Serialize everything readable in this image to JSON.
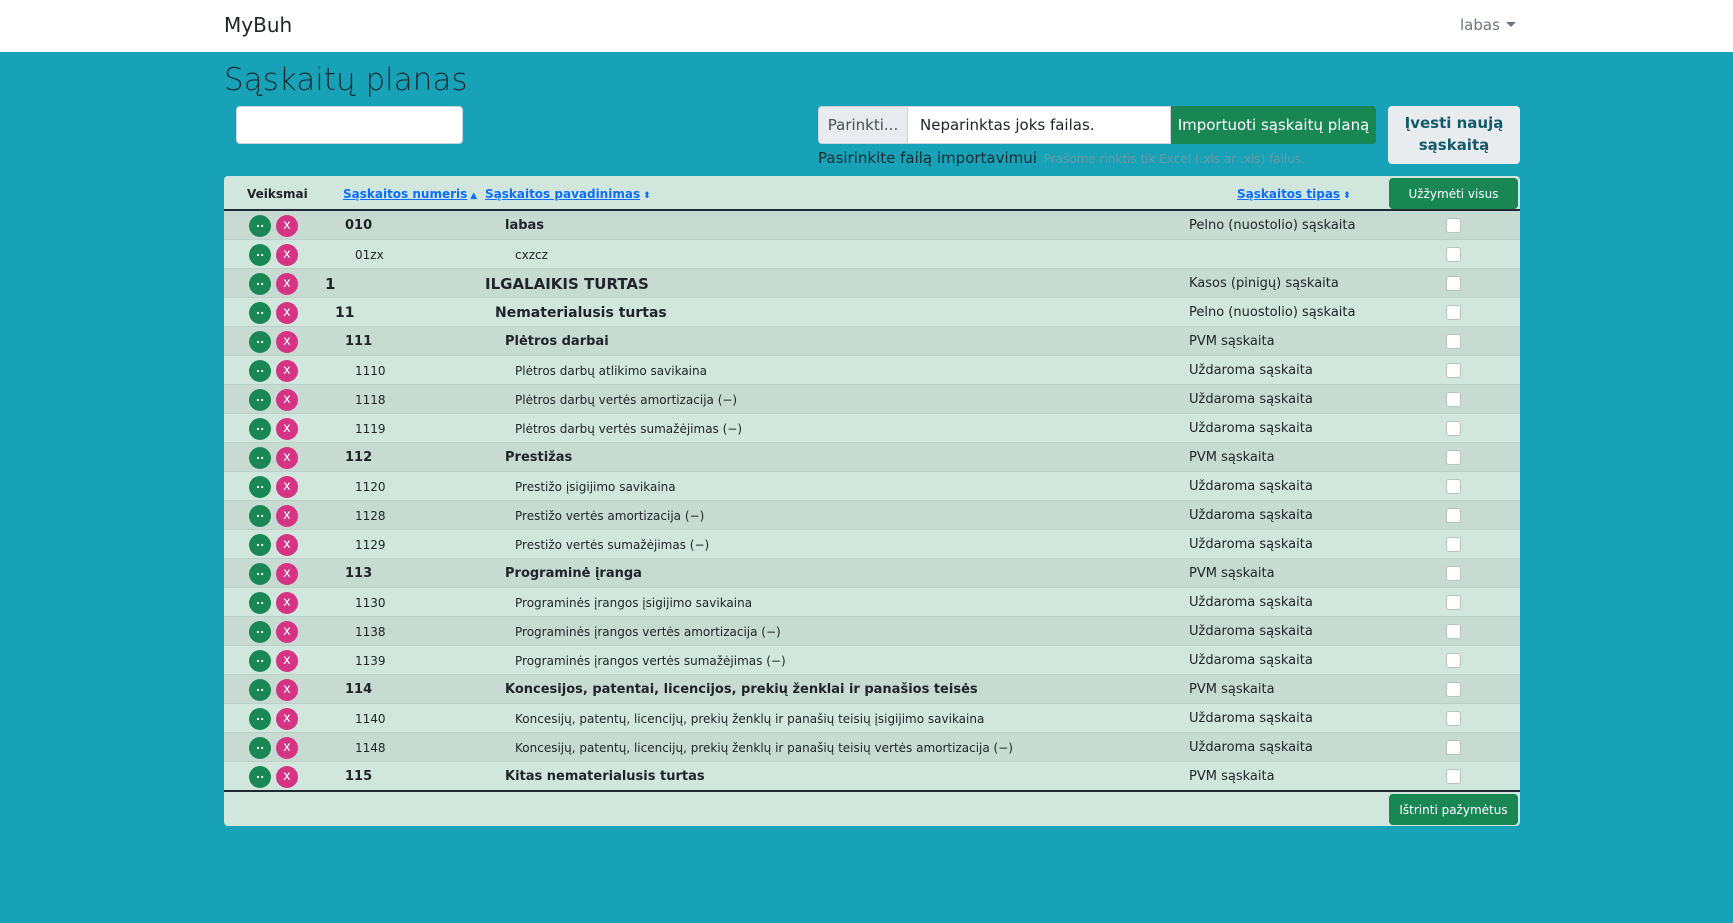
{
  "navbar": {
    "brand": "MyBuh",
    "user_label": "labas"
  },
  "page_title": "Sąskaitų planas",
  "import": {
    "choose_label": "Parinkti...",
    "file_name": "Neparinktas joks failas.",
    "import_button": "Importuoti sąskaitų planą",
    "help": "Pasirinkite failą importavimui",
    "help_muted": "Prašome rinktis tik Excel (.xls ar .xls) failus."
  },
  "new_account_button": "Įvesti naują sąskaitą",
  "table": {
    "columns": {
      "actions": "Veiksmai",
      "number": "Sąskaitos numeris",
      "name": "Sąskaitos pavadinimas",
      "type": "Sąskaitos tipas"
    },
    "check_all_button": "Užžymėti visus",
    "edit_label": "..",
    "delete_label": "x",
    "rows": [
      {
        "level": 3,
        "number": "010",
        "name": "labas",
        "type": "Pelno (nuostolio) sąskaita"
      },
      {
        "level": 4,
        "number": "01zx",
        "name": "cxzcz",
        "type": ""
      },
      {
        "level": 1,
        "number": "1",
        "name": "ILGALAIKIS TURTAS",
        "type": "Kasos (pinigų) sąskaita"
      },
      {
        "level": 2,
        "number": "11",
        "name": "Nematerialusis turtas",
        "type": "Pelno (nuostolio) sąskaita"
      },
      {
        "level": 3,
        "number": "111",
        "name": "Plėtros darbai",
        "type": "PVM sąskaita"
      },
      {
        "level": 4,
        "number": "1110",
        "name": "Plėtros darbų atlikimo savikaina",
        "type": "Uždaroma sąskaita"
      },
      {
        "level": 4,
        "number": "1118",
        "name": "Plėtros darbų vertės amortizacija (−)",
        "type": "Uždaroma sąskaita"
      },
      {
        "level": 4,
        "number": "1119",
        "name": "Plėtros darbų vertės sumažėjimas (−)",
        "type": "Uždaroma sąskaita"
      },
      {
        "level": 3,
        "number": "112",
        "name": "Prestižas",
        "type": "PVM sąskaita"
      },
      {
        "level": 4,
        "number": "1120",
        "name": "Prestižo įsigijimo savikaina",
        "type": "Uždaroma sąskaita"
      },
      {
        "level": 4,
        "number": "1128",
        "name": "Prestižo vertės amortizacija (−)",
        "type": "Uždaroma sąskaita"
      },
      {
        "level": 4,
        "number": "1129",
        "name": "Prestižo vertės sumažėjimas (−)",
        "type": "Uždaroma sąskaita"
      },
      {
        "level": 3,
        "number": "113",
        "name": "Programinė įranga",
        "type": "PVM sąskaita"
      },
      {
        "level": 4,
        "number": "1130",
        "name": "Programinės įrangos įsigijimo savikaina",
        "type": "Uždaroma sąskaita"
      },
      {
        "level": 4,
        "number": "1138",
        "name": "Programinės įrangos vertės amortizacija (−)",
        "type": "Uždaroma sąskaita"
      },
      {
        "level": 4,
        "number": "1139",
        "name": "Programinės įrangos vertės sumažėjimas (−)",
        "type": "Uždaroma sąskaita"
      },
      {
        "level": 3,
        "number": "114",
        "name": "Koncesijos, patentai, licencijos, prekių ženklai ir panašios teisės",
        "type": "PVM sąskaita"
      },
      {
        "level": 4,
        "number": "1140",
        "name": "Koncesijų, patentų, licencijų, prekių ženklų ir panašių teisių įsigijimo savikaina",
        "type": "Uždaroma sąskaita"
      },
      {
        "level": 4,
        "number": "1148",
        "name": "Koncesijų, patentų, licencijų, prekių ženklų ir panašių teisių vertės amortizacija (−)",
        "type": "Uždaroma sąskaita"
      },
      {
        "level": 3,
        "number": "115",
        "name": "Kitas nematerialusis turtas",
        "type": "PVM sąskaita"
      }
    ],
    "delete_selected_button": "Ištrinti pažymėtus"
  },
  "colors": {
    "page_bg": "#17a2b8",
    "table_bg": "#d1e7dd",
    "success": "#198754",
    "danger": "#d63384",
    "link": "#0d6efd"
  }
}
